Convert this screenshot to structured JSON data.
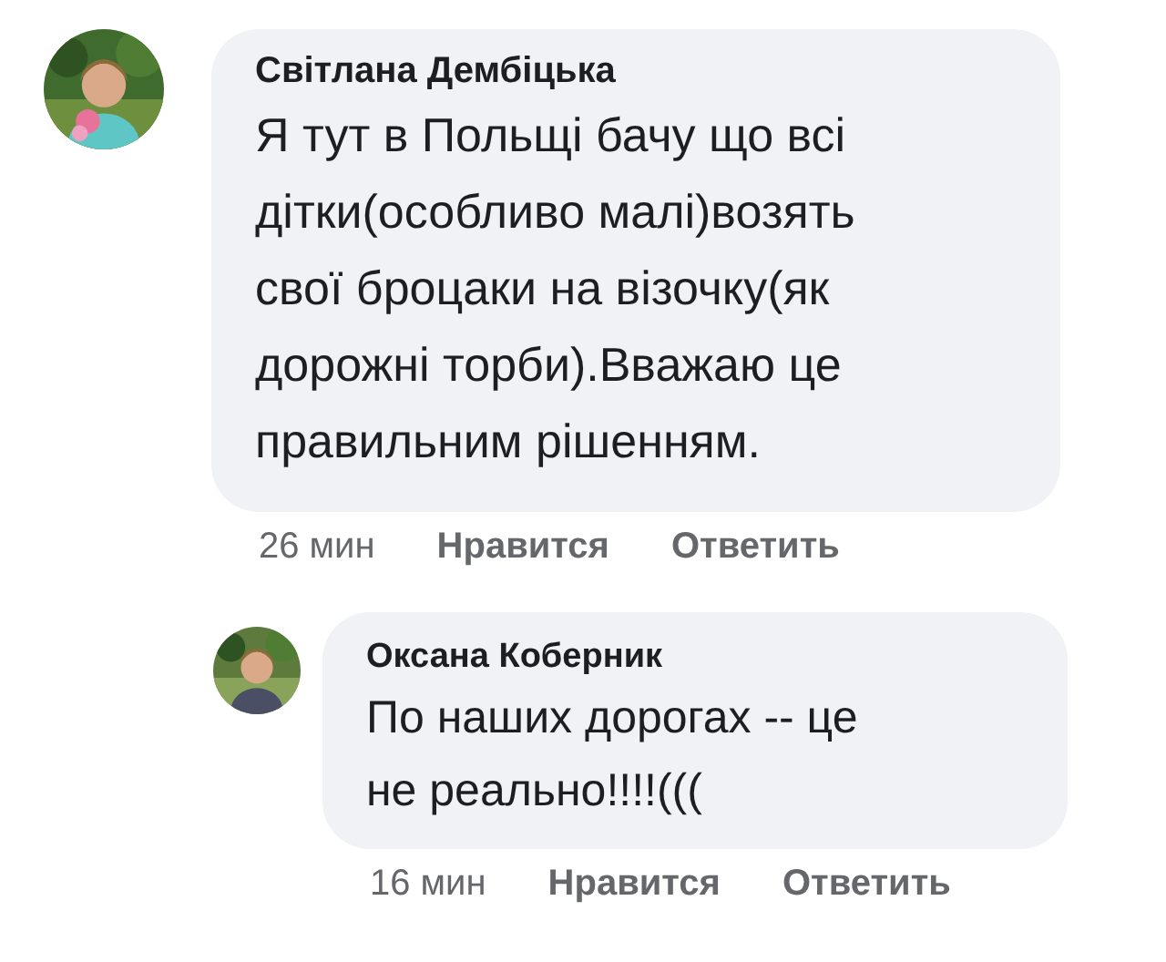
{
  "comments": [
    {
      "author": "Світлана Дембіцька",
      "text": "Я тут в Польщі бачу що всі дітки(особливо малі)возять свої броцаки на візочку(як дорожні торби).Вважаю це правильним рішенням.",
      "time": "26 мин",
      "actions": [
        "Нравится",
        "Ответить"
      ],
      "reply": false
    },
    {
      "author": "Оксана Коберник",
      "text": "По наших дорогах -- це не реально!!!!(((",
      "time": "16 мин",
      "actions": [
        "Нравится",
        "Ответить"
      ],
      "reply": true
    }
  ]
}
